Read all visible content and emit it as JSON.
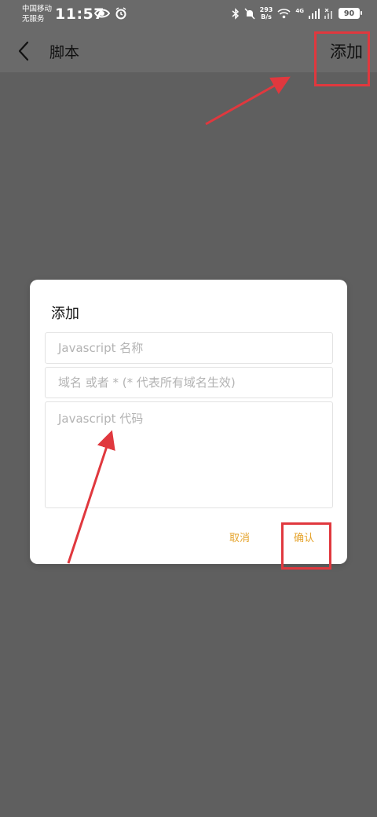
{
  "status_bar": {
    "carrier_line1": "中国移动",
    "carrier_line2": "无服务",
    "time": "11:57",
    "net_speed_value": "293",
    "net_speed_unit": "B/s",
    "network": "4G",
    "battery": "90"
  },
  "header": {
    "title": "脚本",
    "add_label": "添加"
  },
  "dialog": {
    "title": "添加",
    "name_placeholder": "Javascript 名称",
    "domain_placeholder": "域名 或者 * (* 代表所有域名生效)",
    "code_placeholder": "Javascript 代码",
    "cancel_label": "取消",
    "confirm_label": "确认"
  },
  "colors": {
    "accent": "#e5a32b",
    "annotation": "#e0383e",
    "overlay": "#5f5f5f"
  }
}
